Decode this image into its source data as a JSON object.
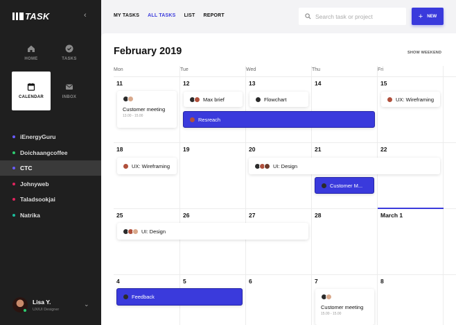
{
  "app": {
    "logo": "TASK"
  },
  "sidebar": {
    "nav": [
      {
        "label": "HOME",
        "icon": "home-icon"
      },
      {
        "label": "TASKS",
        "icon": "tasks-icon"
      },
      {
        "label": "CALENDAR",
        "icon": "calendar-icon"
      },
      {
        "label": "INBOX",
        "icon": "inbox-icon"
      }
    ],
    "projects": [
      {
        "label": "iEnergyGuru",
        "color": "#6a5cff"
      },
      {
        "label": "Doichaangcoffee",
        "color": "#2ecc71"
      },
      {
        "label": "CTC",
        "color": "#6a5cff"
      },
      {
        "label": "Johnyweb",
        "color": "#e0245e"
      },
      {
        "label": "Taladsookjai",
        "color": "#e0245e"
      },
      {
        "label": "Natrika",
        "color": "#1abc9c"
      }
    ],
    "user": {
      "name": "Lisa Y.",
      "role": "UX/UI Designer"
    }
  },
  "header": {
    "tabs": [
      "MY TASKS",
      "ALL TASKS",
      "LIST",
      "REPORT"
    ],
    "active_tab": "ALL TASKS",
    "search_placeholder": "Search task or project",
    "new_label": "NEW",
    "accent": "#3a3adc"
  },
  "calendar": {
    "month": "February 2019",
    "show_weekend": "SHOW WEEKEND",
    "weekdays": [
      "Mon",
      "Tue",
      "Wed",
      "Thu",
      "Fri"
    ],
    "weeks": [
      [
        "11",
        "12",
        "13",
        "14",
        "15"
      ],
      [
        "18",
        "19",
        "20",
        "21",
        "22"
      ],
      [
        "25",
        "26",
        "27",
        "28",
        "March 1"
      ],
      [
        "4",
        "5",
        "6",
        "7",
        "8"
      ]
    ],
    "events": {
      "customer_meeting_1": {
        "title": "Customer meeting",
        "time": "13.00 - 15.00"
      },
      "max_brief": {
        "title": "Max brief"
      },
      "flowchart": {
        "title": "Flowchart"
      },
      "ux_wireframing_1": {
        "title": "UX: Wireframing"
      },
      "resreach": {
        "title": "Resreach"
      },
      "ux_wireframing_2": {
        "title": "UX: Wireframing"
      },
      "ui_design_1": {
        "title": "UI: Design"
      },
      "customer_m": {
        "title": "Customer M..."
      },
      "ui_design_2": {
        "title": "UI: Design"
      },
      "feedback": {
        "title": "Feedback"
      },
      "customer_meeting_2": {
        "title": "Customer meeting",
        "time": "15.00 - 15.00"
      }
    }
  }
}
